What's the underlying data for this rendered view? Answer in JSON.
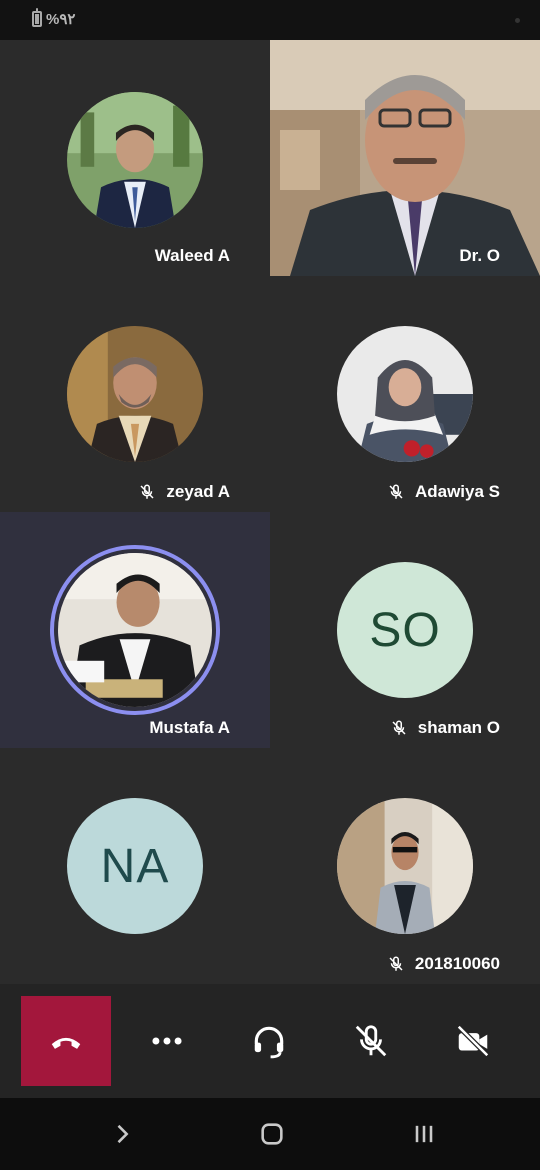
{
  "status_bar": {
    "battery_text": "%۹۲"
  },
  "participants": [
    {
      "name": "Waleed A",
      "muted": false,
      "type": "photo"
    },
    {
      "name": "Dr. O",
      "muted": true,
      "type": "video"
    },
    {
      "name": "zeyad A",
      "muted": true,
      "type": "photo"
    },
    {
      "name": "Adawiya S",
      "muted": true,
      "type": "photo"
    },
    {
      "name": "Mustafa A",
      "muted": false,
      "type": "photo",
      "speaking": true
    },
    {
      "name": "shaman O",
      "muted": true,
      "type": "initials",
      "initials": "SO",
      "bg": "#cfe7d7",
      "fg": "#1f4a34"
    },
    {
      "name": "",
      "muted": false,
      "type": "initials",
      "initials": "NA",
      "bg": "#bcd9da",
      "fg": "#1f4a4c"
    },
    {
      "name": "201810060",
      "muted": true,
      "type": "photo"
    }
  ],
  "controls": {
    "hangup_icon": "phone-hangup-icon",
    "more_icon": "more-dots-icon",
    "audio_icon": "headset-icon",
    "mic_icon": "mic-off-icon",
    "camera_icon": "camera-off-icon",
    "hangup_color": "#a3173c"
  },
  "navbar": {
    "back_icon": "chevron-icon",
    "home_icon": "home-icon",
    "recents_icon": "recents-icon"
  },
  "colors": {
    "tile": "#2b2b2b",
    "speaking_tile": "#30303e",
    "speaking_ring": "#8c8ff0"
  }
}
